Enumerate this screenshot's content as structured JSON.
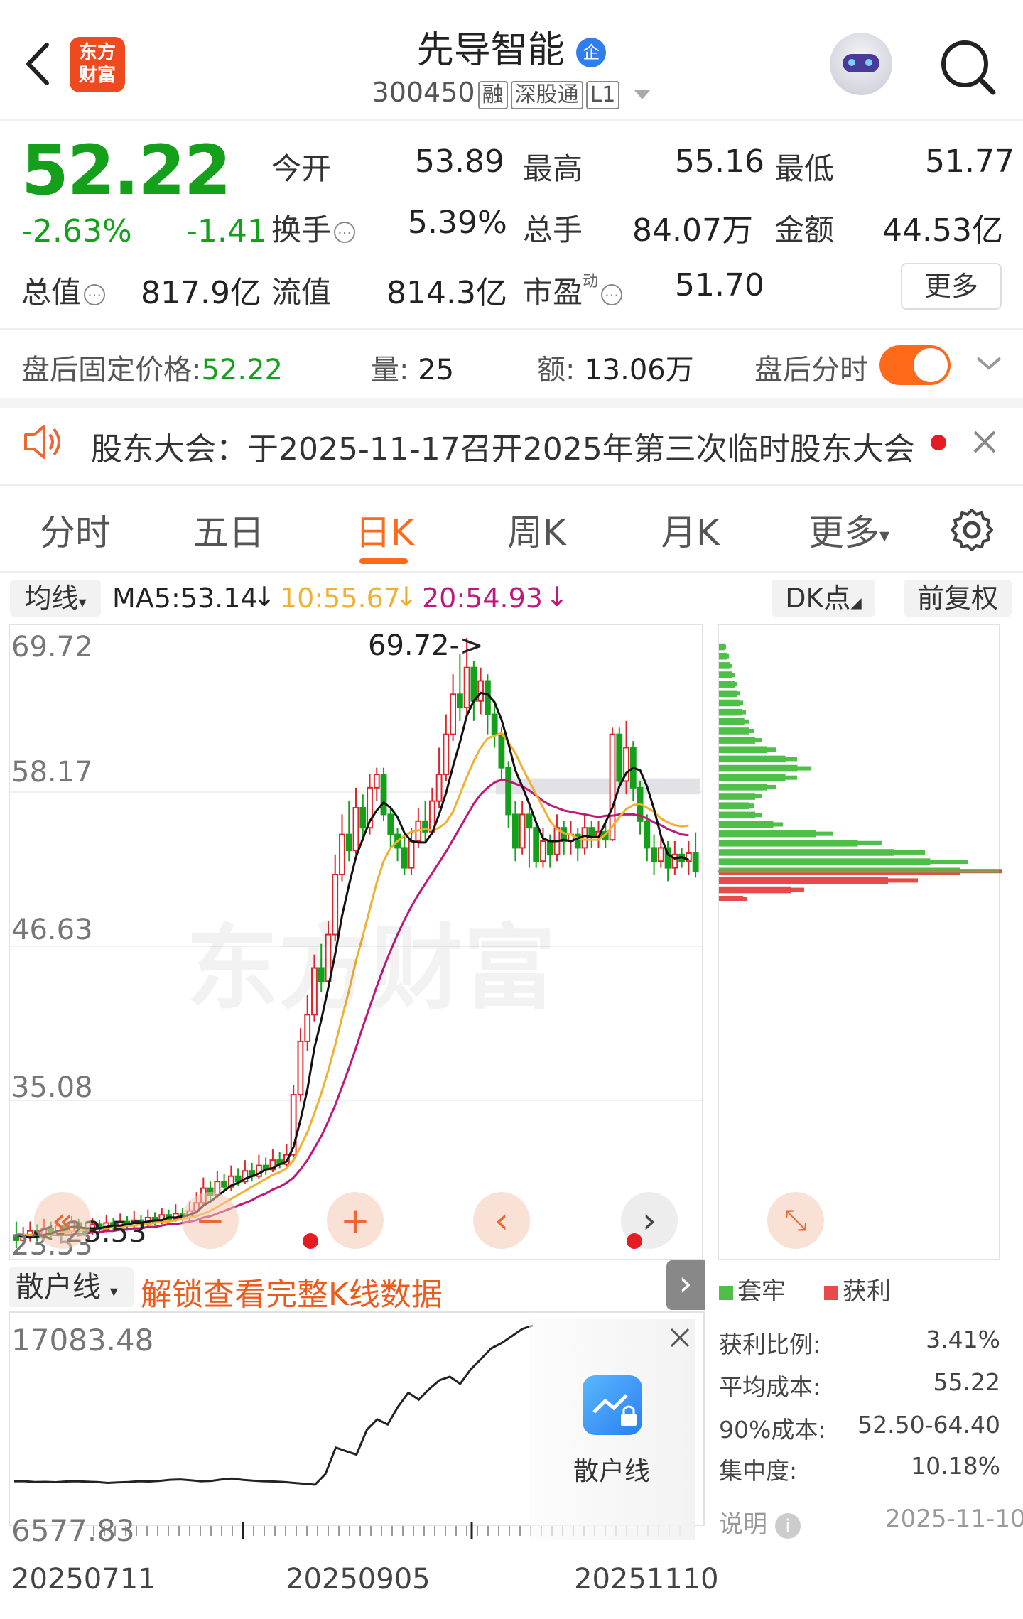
{
  "header": {
    "stock_name": "先导智能",
    "badge": "企",
    "code": "300450",
    "tags": [
      "融",
      "深股通",
      "L1"
    ],
    "logo_text": "东方财富"
  },
  "quote": {
    "price": "52.22",
    "change_pct": "-2.63%",
    "change": "-1.41",
    "open_label": "今开",
    "open": "53.89",
    "high_label": "最高",
    "high": "55.16",
    "low_label": "最低",
    "low": "51.77",
    "turnover_label": "换手",
    "turnover": "5.39%",
    "volume_label": "总手",
    "volume": "84.07万",
    "amount_label": "金额",
    "amount": "44.53亿",
    "mktcap_label": "总值",
    "mktcap": "817.9亿",
    "float_label": "流值",
    "float": "814.3亿",
    "pe_label": "市盈",
    "pe_sup": "动",
    "pe": "51.70",
    "more_label": "更多"
  },
  "after_hours": {
    "price_label": "盘后固定价格:",
    "price": "52.22",
    "vol_label": "量:",
    "vol": "25",
    "amt_label": "额:",
    "amt": "13.06万",
    "toggle_label": "盘后分时",
    "toggle_on": true
  },
  "notice": {
    "text": "股东大会：于2025-11-17召开2025年第三次临时股东大会"
  },
  "tabs": [
    "分时",
    "五日",
    "日K",
    "周K",
    "月K",
    "更多"
  ],
  "active_tab": "日K",
  "ma_bar": {
    "selector": "均线",
    "ma5": "MA5:53.14",
    "ma10": "10:55.67",
    "ma20": "20:54.93",
    "dk_label": "DK点",
    "adj_label": "前复权"
  },
  "kline_axis": [
    "69.72",
    "58.17",
    "46.63",
    "35.08",
    "23.53"
  ],
  "kline_annotations": {
    "high_mark": "69.72->",
    "low_mark": "<-23.53"
  },
  "watermark": "东方财富",
  "sub_panel": {
    "selector": "散户线",
    "unlock_text": "解锁查看完整K线数据",
    "axis_top": "17083.48",
    "axis_bottom": "6577.83",
    "dates": [
      "20250711",
      "20250905",
      "20251110"
    ],
    "overlay_label": "散户线"
  },
  "chips": {
    "legend_trapped": "套牢",
    "legend_profit": "获利",
    "rows": [
      {
        "label": "获利比例:",
        "value": "3.41%"
      },
      {
        "label": "平均成本:",
        "value": "55.22"
      },
      {
        "label": "90%成本:",
        "value": "52.50-64.40"
      },
      {
        "label": "集中度:",
        "value": "10.18%"
      }
    ],
    "note_label": "说明",
    "date": "2025-11-10"
  },
  "colors": {
    "up": "#e0242b",
    "down": "#14a01b",
    "accent": "#ff6a1a",
    "ma5": "#111111",
    "ma10": "#f0b030",
    "ma20": "#c0187a"
  },
  "kline_series_ma_note": "",
  "candles": [
    [
      25,
      24.6,
      26.0,
      24.0
    ],
    [
      24.6,
      24.9,
      25.6,
      24.2
    ],
    [
      24.9,
      25.3,
      26.0,
      24.5
    ],
    [
      25.3,
      24.8,
      25.8,
      24.5
    ],
    [
      24.8,
      25.5,
      26.2,
      24.6
    ],
    [
      25.5,
      25.1,
      26.0,
      24.7
    ],
    [
      25.1,
      25.7,
      26.3,
      24.9
    ],
    [
      25.7,
      25.3,
      26.1,
      25.0
    ],
    [
      25.3,
      25.9,
      26.4,
      25.1
    ],
    [
      25.9,
      25.5,
      26.2,
      25.2
    ],
    [
      25.5,
      25.2,
      26.0,
      24.9
    ],
    [
      25.2,
      25.8,
      26.3,
      25.0
    ],
    [
      25.8,
      25.4,
      26.1,
      25.1
    ],
    [
      25.4,
      25.9,
      26.5,
      25.2
    ],
    [
      25.9,
      25.6,
      26.3,
      25.3
    ],
    [
      25.6,
      26.0,
      26.6,
      25.4
    ],
    [
      26.0,
      25.7,
      26.4,
      25.4
    ],
    [
      25.7,
      26.1,
      26.8,
      25.5
    ],
    [
      26.1,
      25.8,
      26.5,
      25.5
    ],
    [
      25.8,
      26.3,
      26.9,
      25.6
    ],
    [
      26.3,
      26.0,
      26.7,
      25.7
    ],
    [
      26.0,
      26.5,
      27.0,
      25.8
    ],
    [
      26.5,
      26.2,
      26.9,
      25.9
    ],
    [
      26.2,
      26.6,
      27.3,
      26.0
    ],
    [
      26.6,
      26.3,
      27.0,
      26.0
    ],
    [
      26.3,
      26.8,
      27.5,
      26.1
    ],
    [
      26.8,
      27.4,
      28.2,
      26.6
    ],
    [
      27.4,
      28.5,
      29.3,
      27.2
    ],
    [
      28.5,
      28.0,
      29.0,
      27.6
    ],
    [
      28.0,
      29.0,
      29.8,
      27.8
    ],
    [
      29.0,
      28.6,
      29.6,
      28.2
    ],
    [
      28.6,
      29.4,
      30.2,
      28.3
    ],
    [
      29.4,
      29.0,
      30.0,
      28.7
    ],
    [
      29.0,
      29.8,
      30.6,
      28.8
    ],
    [
      29.8,
      29.4,
      30.4,
      29.0
    ],
    [
      29.4,
      30.2,
      31.0,
      29.2
    ],
    [
      30.2,
      29.9,
      30.8,
      29.5
    ],
    [
      29.9,
      30.6,
      31.4,
      29.7
    ],
    [
      30.6,
      30.3,
      31.2,
      30.0
    ],
    [
      30.3,
      31.0,
      31.8,
      30.0
    ],
    [
      31.0,
      35.5,
      36.2,
      30.8
    ],
    [
      35.5,
      39.5,
      40.5,
      35.0
    ],
    [
      39.5,
      41.5,
      43.0,
      38.8
    ],
    [
      41.5,
      45.0,
      46.0,
      41.0
    ],
    [
      45.0,
      44.0,
      46.8,
      43.2
    ],
    [
      44.0,
      47.5,
      48.5,
      43.5
    ],
    [
      47.5,
      52.0,
      53.5,
      47.0
    ],
    [
      52.0,
      55.0,
      56.5,
      51.5
    ],
    [
      55.0,
      53.8,
      57.5,
      53.0
    ],
    [
      53.8,
      57.0,
      58.5,
      53.5
    ],
    [
      57.0,
      55.5,
      58.0,
      54.5
    ],
    [
      55.5,
      58.5,
      59.5,
      55.0
    ],
    [
      58.5,
      59.5,
      60.0,
      57.5
    ],
    [
      59.5,
      56.5,
      60.0,
      56.0
    ],
    [
      56.5,
      55.0,
      57.0,
      54.0
    ],
    [
      55.0,
      54.0,
      55.5,
      53.0
    ],
    [
      54.0,
      52.5,
      55.0,
      52.0
    ],
    [
      52.5,
      54.5,
      55.5,
      52.0
    ],
    [
      54.5,
      56.0,
      57.0,
      54.0
    ],
    [
      56.0,
      55.2,
      57.5,
      54.5
    ],
    [
      55.2,
      57.5,
      58.5,
      55.0
    ],
    [
      57.5,
      59.5,
      61.5,
      57.0
    ],
    [
      59.5,
      62.5,
      64.0,
      59.0
    ],
    [
      62.5,
      65.5,
      67.0,
      62.0
    ],
    [
      65.5,
      64.5,
      68.5,
      63.5
    ],
    [
      64.5,
      67.5,
      69.72,
      64.0
    ],
    [
      67.5,
      65.0,
      68.0,
      63.5
    ],
    [
      65.0,
      66.5,
      67.5,
      64.0
    ],
    [
      66.5,
      64.0,
      67.0,
      62.5
    ],
    [
      64.0,
      62.5,
      65.0,
      61.5
    ],
    [
      62.5,
      60.0,
      63.0,
      59.0
    ],
    [
      60.0,
      56.5,
      60.5,
      55.5
    ],
    [
      56.5,
      54.0,
      57.5,
      53.0
    ],
    [
      54.0,
      56.5,
      57.5,
      53.5
    ],
    [
      56.5,
      55.5,
      57.0,
      52.5
    ],
    [
      55.5,
      53.0,
      56.0,
      52.5
    ],
    [
      53.0,
      54.5,
      55.5,
      52.5
    ],
    [
      54.5,
      53.5,
      55.0,
      52.5
    ],
    [
      53.5,
      55.5,
      56.5,
      53.0
    ],
    [
      55.5,
      54.5,
      56.0,
      53.5
    ],
    [
      54.5,
      55.0,
      56.0,
      53.5
    ],
    [
      55.0,
      54.0,
      55.5,
      53.0
    ],
    [
      54.0,
      55.5,
      56.5,
      53.5
    ],
    [
      55.5,
      54.8,
      56.0,
      54.0
    ],
    [
      54.8,
      55.2,
      56.0,
      54.0
    ],
    [
      55.2,
      54.6,
      55.8,
      54.0
    ],
    [
      54.6,
      62.5,
      63.0,
      54.5
    ],
    [
      62.5,
      59.0,
      63.0,
      58.5
    ],
    [
      59.0,
      61.5,
      63.5,
      58.0
    ],
    [
      61.5,
      58.5,
      62.0,
      57.5
    ],
    [
      58.5,
      56.0,
      59.0,
      55.0
    ],
    [
      56.0,
      54.0,
      56.5,
      53.0
    ],
    [
      54.0,
      53.0,
      55.0,
      52.0
    ],
    [
      53.0,
      54.0,
      55.0,
      52.5
    ],
    [
      54.0,
      52.5,
      54.5,
      51.5
    ],
    [
      52.5,
      53.5,
      54.5,
      52.0
    ],
    [
      53.5,
      53.0,
      54.0,
      52.5
    ],
    [
      53.0,
      53.6,
      54.5,
      52.0
    ],
    [
      53.6,
      52.22,
      55.16,
      51.77
    ]
  ],
  "ma5_line": [
    25.0,
    24.9,
    24.8,
    24.9,
    25.0,
    25.1,
    25.3,
    25.4,
    25.6,
    25.6,
    25.5,
    25.5,
    25.5,
    25.6,
    25.7,
    25.7,
    25.8,
    25.9,
    25.9,
    26.0,
    26.1,
    26.1,
    26.3,
    26.3,
    26.4,
    26.5,
    26.7,
    27.2,
    27.5,
    27.9,
    28.3,
    28.7,
    28.9,
    29.2,
    29.4,
    29.6,
    29.9,
    30.0,
    30.3,
    30.5,
    31.6,
    33.6,
    35.9,
    39.0,
    41.1,
    43.5,
    46.0,
    48.9,
    51.2,
    53.3,
    54.7,
    56.0,
    56.8,
    57.4,
    57.0,
    56.3,
    55.1,
    54.5,
    54.4,
    54.4,
    55.1,
    56.5,
    58.1,
    60.1,
    61.9,
    63.9,
    65.0,
    65.6,
    65.5,
    64.9,
    63.6,
    61.8,
    59.8,
    58.6,
    57.3,
    55.9,
    54.7,
    54.5,
    54.5,
    54.6,
    54.5,
    54.7,
    54.9,
    54.8,
    54.8,
    55.9,
    57.0,
    58.6,
    59.6,
    60.0,
    59.8,
    58.6,
    56.9,
    54.9,
    53.5,
    53.2,
    53.3,
    53.1
  ],
  "ma10_line": [
    25.0,
    25.0,
    25.0,
    25.0,
    25.0,
    25.0,
    25.1,
    25.2,
    25.3,
    25.3,
    25.4,
    25.4,
    25.5,
    25.5,
    25.6,
    25.6,
    25.7,
    25.7,
    25.8,
    25.8,
    25.9,
    26.0,
    26.0,
    26.1,
    26.2,
    26.3,
    26.4,
    26.6,
    26.8,
    27.1,
    27.4,
    27.7,
    28.0,
    28.3,
    28.6,
    28.9,
    29.2,
    29.5,
    29.7,
    30.0,
    30.6,
    31.6,
    32.7,
    34.1,
    35.6,
    37.3,
    39.2,
    41.3,
    43.3,
    45.5,
    47.4,
    49.4,
    51.4,
    53.0,
    54.0,
    54.5,
    54.9,
    55.2,
    55.3,
    55.4,
    55.3,
    55.5,
    55.9,
    56.7,
    58.0,
    59.3,
    60.5,
    61.5,
    62.2,
    62.4,
    62.6,
    61.9,
    61.1,
    60.0,
    59.0,
    58.0,
    57.0,
    56.0,
    55.4,
    55.1,
    55.0,
    54.7,
    54.6,
    54.6,
    54.6,
    55.0,
    55.6,
    56.3,
    56.9,
    57.2,
    57.3,
    57.0,
    56.7,
    56.2,
    55.9,
    55.7,
    55.6,
    55.67
  ],
  "ma20_line": [
    25.0,
    25.0,
    25.0,
    25.0,
    25.0,
    25.0,
    25.0,
    25.0,
    25.0,
    25.1,
    25.1,
    25.2,
    25.2,
    25.3,
    25.3,
    25.4,
    25.4,
    25.5,
    25.5,
    25.6,
    25.6,
    25.7,
    25.8,
    25.8,
    25.9,
    26.0,
    26.1,
    26.3,
    26.4,
    26.6,
    26.8,
    27.0,
    27.2,
    27.4,
    27.6,
    27.9,
    28.1,
    28.4,
    28.6,
    28.9,
    29.3,
    29.9,
    30.6,
    31.5,
    32.4,
    33.5,
    34.7,
    36.1,
    37.5,
    39.0,
    40.6,
    42.1,
    43.6,
    45.0,
    46.3,
    47.5,
    48.6,
    49.6,
    50.5,
    51.3,
    52.1,
    52.9,
    53.7,
    54.6,
    55.5,
    56.4,
    57.3,
    58.0,
    58.5,
    58.9,
    59.1,
    59.0,
    58.8,
    58.6,
    58.3,
    57.9,
    57.5,
    57.2,
    57.0,
    56.8,
    56.7,
    56.6,
    56.5,
    56.4,
    56.3,
    56.4,
    56.4,
    56.5,
    56.5,
    56.5,
    56.4,
    56.2,
    55.9,
    55.7,
    55.4,
    55.2,
    55.0,
    54.93
  ],
  "chip_bars": [
    [
      69.0,
      10
    ],
    [
      68.3,
      14
    ],
    [
      67.6,
      18
    ],
    [
      66.9,
      22
    ],
    [
      66.2,
      26
    ],
    [
      65.5,
      30
    ],
    [
      64.8,
      34
    ],
    [
      64.1,
      38
    ],
    [
      63.4,
      42
    ],
    [
      62.7,
      50
    ],
    [
      62.0,
      60
    ],
    [
      61.3,
      80
    ],
    [
      60.6,
      110
    ],
    [
      59.9,
      130
    ],
    [
      59.2,
      110
    ],
    [
      58.5,
      80
    ],
    [
      57.8,
      60
    ],
    [
      57.1,
      50
    ],
    [
      56.4,
      60
    ],
    [
      55.7,
      90
    ],
    [
      55.0,
      160
    ],
    [
      54.3,
      230
    ],
    [
      53.6,
      290
    ],
    [
      52.9,
      350
    ],
    [
      52.2,
      400
    ],
    [
      51.5,
      280
    ],
    [
      50.8,
      120
    ],
    [
      50.1,
      40
    ]
  ],
  "retail_line": [
    8300,
    8300,
    8250,
    8260,
    8240,
    8280,
    8300,
    8270,
    8250,
    8200,
    8230,
    8250,
    8300,
    8280,
    8320,
    8380,
    8400,
    8350,
    8300,
    8320,
    8400,
    8450,
    8380,
    8330,
    8300,
    8280,
    8250,
    8200,
    8150,
    8100,
    8700,
    10200,
    10000,
    9800,
    11200,
    11800,
    11500,
    12500,
    13300,
    12900,
    13500,
    14000,
    14200,
    13800,
    14600,
    15200,
    15800,
    16100,
    16500,
    16900,
    17083
  ]
}
